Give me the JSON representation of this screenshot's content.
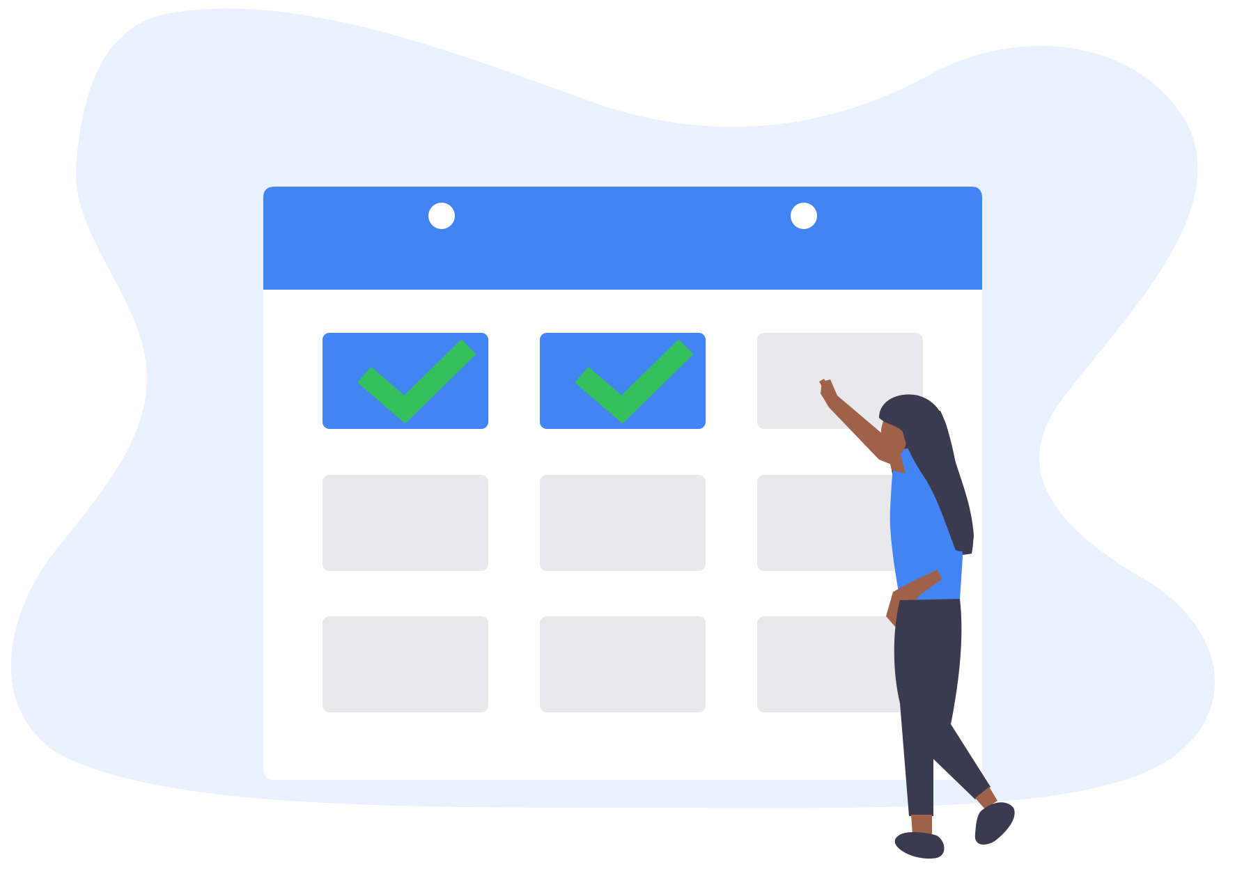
{
  "colors": {
    "background": "#ffffff",
    "blob": "#e8f1fd",
    "calendar_body": "#ffffff",
    "calendar_header": "#4384f3",
    "binding_hole": "#ffffff",
    "cell_done": "#4384f3",
    "cell_empty": "#e9e9eb",
    "checkmark": "#34c05a",
    "hair": "#3b3a4e",
    "skin": "#a0614a",
    "shirt": "#4384f3",
    "pants": "#3b3a4e",
    "shoes": "#3b3a4e"
  },
  "calendar": {
    "rows": 3,
    "columns": 3,
    "cells": [
      {
        "row": 1,
        "col": 1,
        "state": "done",
        "icon": "checkmark-icon"
      },
      {
        "row": 1,
        "col": 2,
        "state": "done",
        "icon": "checkmark-icon"
      },
      {
        "row": 1,
        "col": 3,
        "state": "empty",
        "icon": ""
      },
      {
        "row": 2,
        "col": 1,
        "state": "empty",
        "icon": ""
      },
      {
        "row": 2,
        "col": 2,
        "state": "empty",
        "icon": ""
      },
      {
        "row": 2,
        "col": 3,
        "state": "empty",
        "icon": ""
      },
      {
        "row": 3,
        "col": 1,
        "state": "empty",
        "icon": ""
      },
      {
        "row": 3,
        "col": 2,
        "state": "empty",
        "icon": ""
      },
      {
        "row": 3,
        "col": 3,
        "state": "empty",
        "icon": ""
      }
    ]
  },
  "figure": {
    "icon": "woman-pointing-icon"
  }
}
